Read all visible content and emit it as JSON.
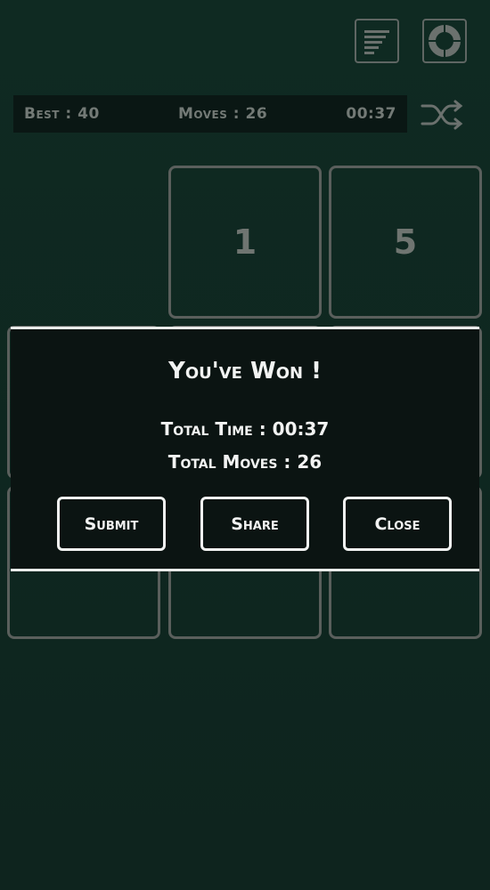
{
  "header": {
    "leaderboard_icon": "leaderboard-icon",
    "settings_icon": "settings-ring-icon",
    "shuffle_icon": "shuffle-icon"
  },
  "stats": {
    "best": "Best : 40",
    "moves": "Moves : 26",
    "time": "00:37"
  },
  "board": {
    "tiles": [
      "1",
      "5",
      "",
      "",
      "",
      "",
      "",
      ""
    ]
  },
  "dialog": {
    "title": "You've Won !",
    "total_time": "Total Time : 00:37",
    "total_moves": "Total Moves : 26",
    "buttons": {
      "submit": "Submit",
      "share": "Share",
      "close": "Close"
    }
  },
  "colors": {
    "background": "#0f2a22",
    "dialog_bg": "#0b1412",
    "accent": "#f2f3f2"
  }
}
